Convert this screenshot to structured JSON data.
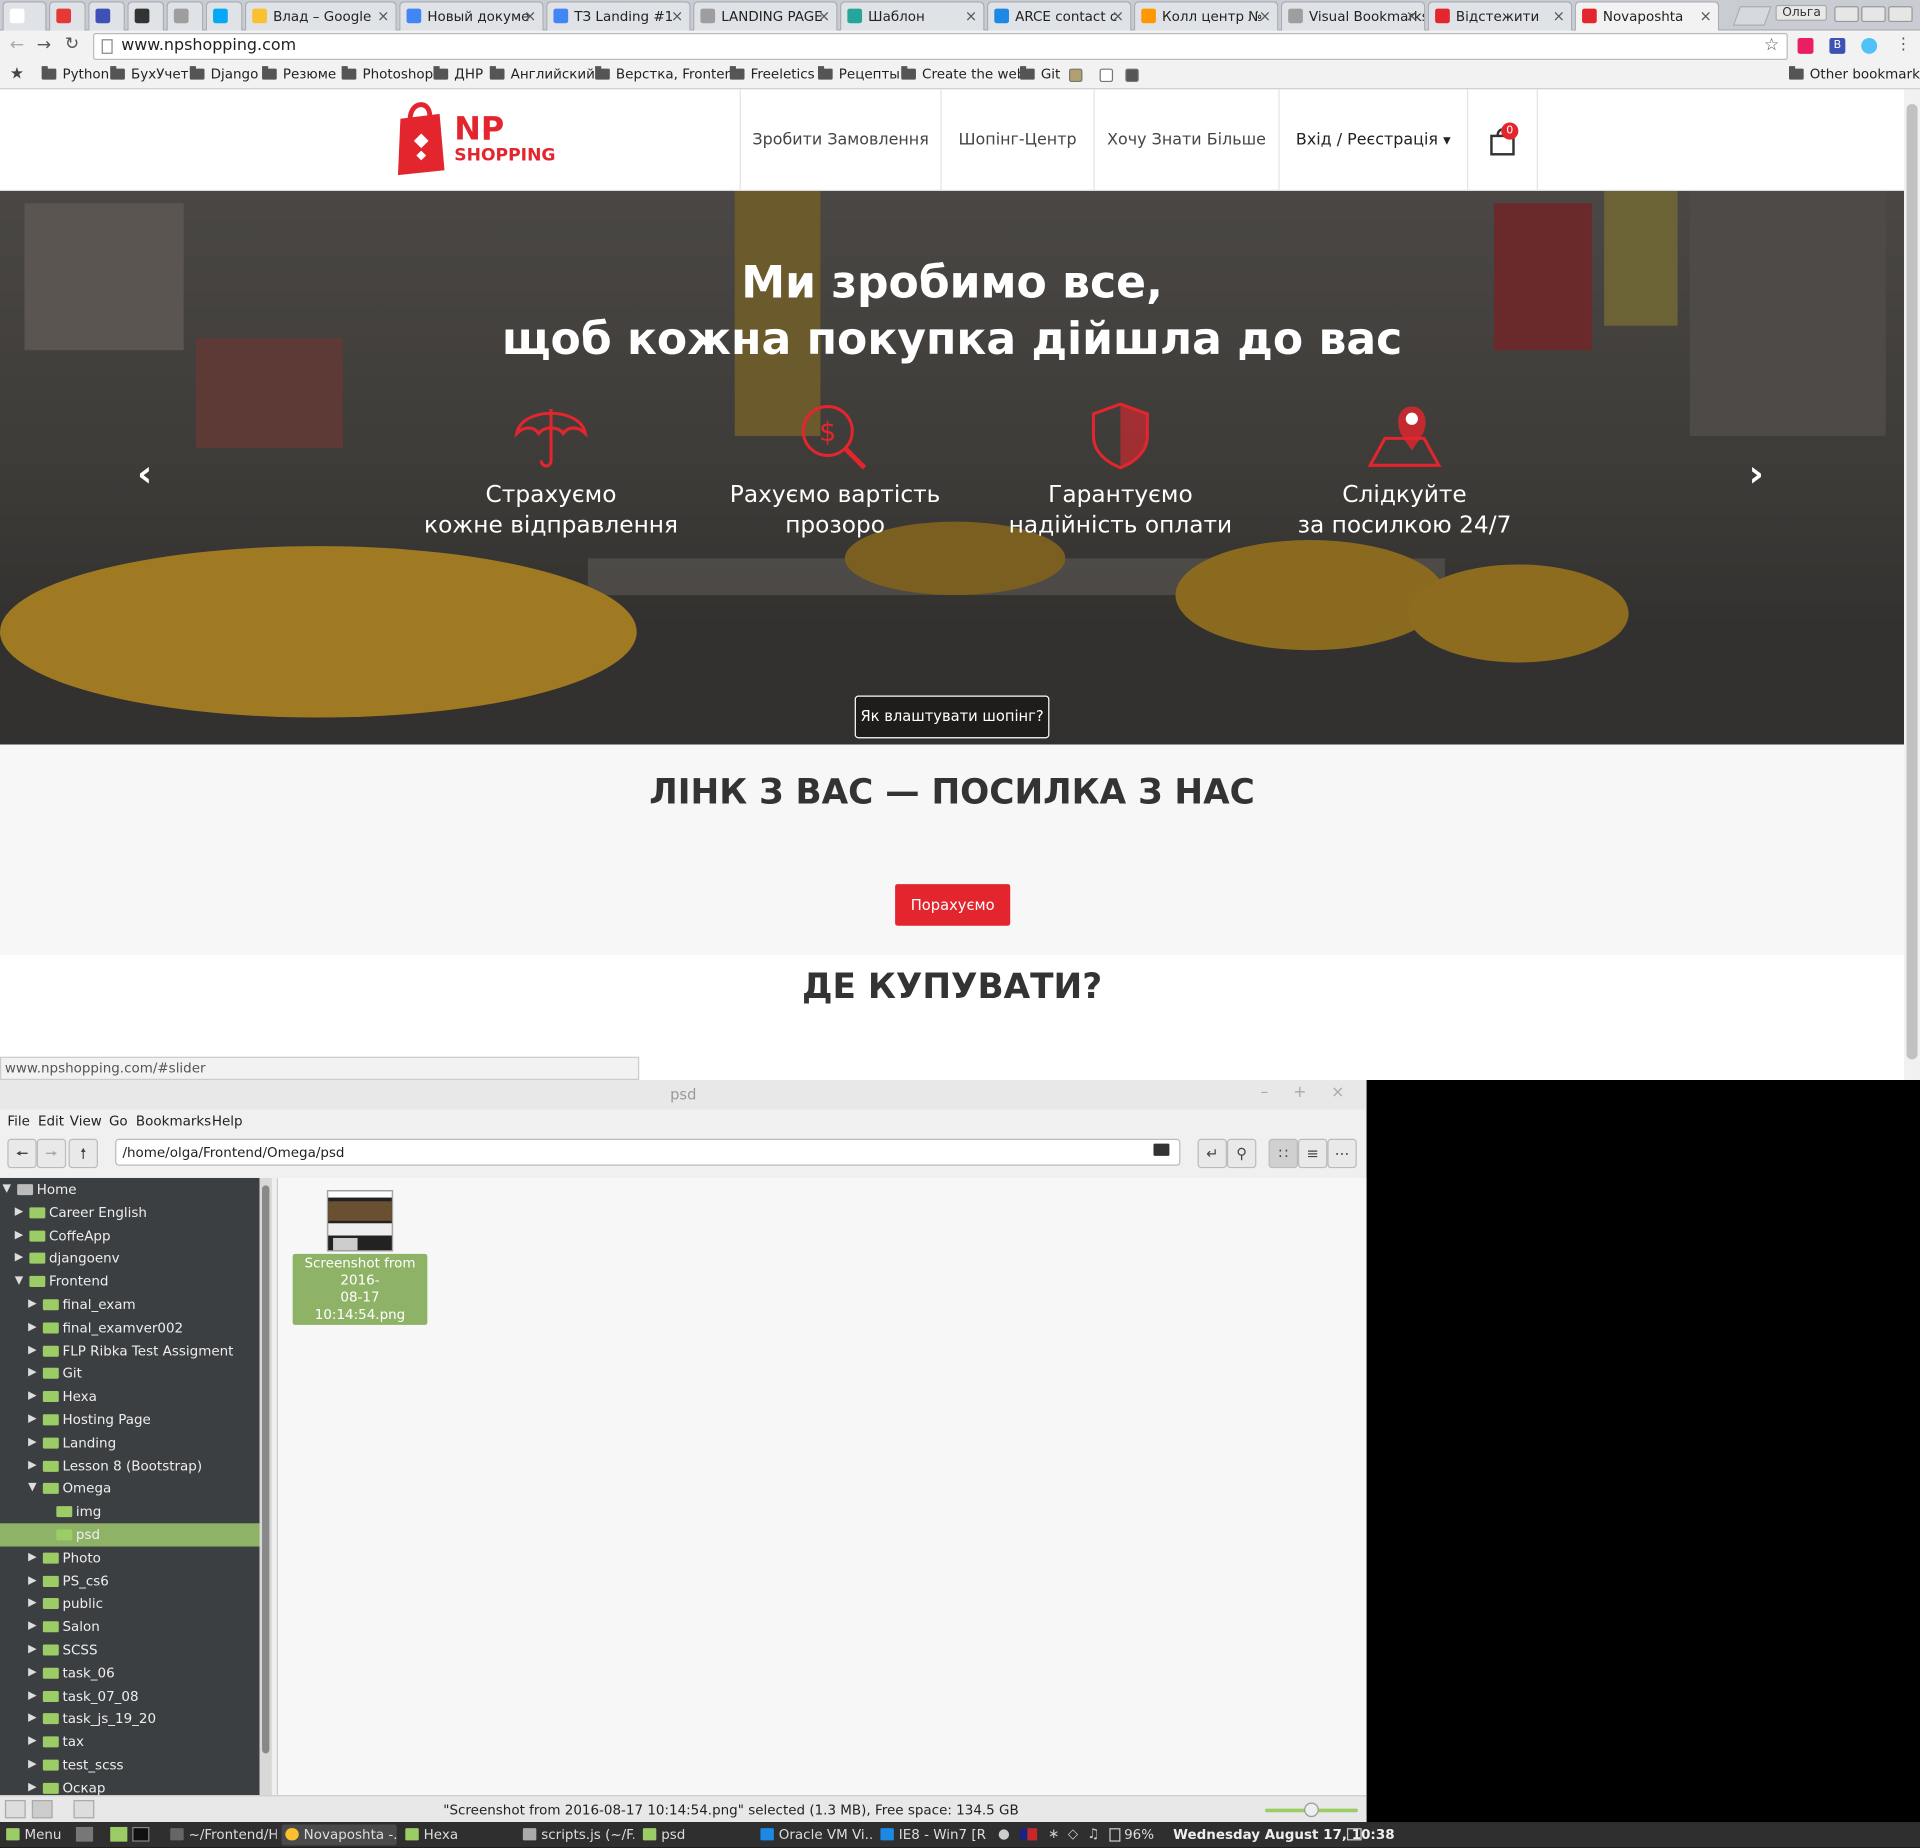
{
  "browser": {
    "tabs": [
      {
        "label": "",
        "favicon_color": "#ffffff"
      },
      {
        "label": "",
        "favicon_color": "#e53935"
      },
      {
        "label": "",
        "favicon_color": "#3f51b5"
      },
      {
        "label": "",
        "favicon_color": "#333333"
      },
      {
        "label": "",
        "favicon_color": "#9e9e9e"
      },
      {
        "label": "",
        "favicon_color": "#03a9f4"
      },
      {
        "label": "Влад – Google",
        "favicon_color": "#fbc02d"
      },
      {
        "label": "Новый докуме",
        "favicon_color": "#4285f4"
      },
      {
        "label": "ТЗ Landing #1",
        "favicon_color": "#4285f4"
      },
      {
        "label": "LANDING PAGE",
        "favicon_color": "#9e9e9e"
      },
      {
        "label": "Шаблон",
        "favicon_color": "#26a69a"
      },
      {
        "label": "ARCE contact c",
        "favicon_color": "#1e88e5"
      },
      {
        "label": "Колл центр №",
        "favicon_color": "#ff9800"
      },
      {
        "label": "Visual Bookmarks",
        "favicon_color": "#9e9e9e"
      },
      {
        "label": "Відстежити",
        "favicon_color": "#e3262e"
      },
      {
        "label": "Novaposhta",
        "favicon_color": "#e3262e"
      }
    ],
    "user_label": "Ольга",
    "url": "www.npshopping.com",
    "bookmarks": [
      "Python",
      "БухУчет",
      "Django",
      "Резюме",
      "Photoshop",
      "ДНР",
      "Английский",
      "Верстка, Frontend",
      "Freeletics",
      "Рецепты",
      "Create the web",
      "Git"
    ],
    "other_bookmarks": "Other bookmarks",
    "status_url": "www.npshopping.com/#slider"
  },
  "site": {
    "logo": {
      "line1": "NP",
      "line2": "SHOPPING"
    },
    "menu": [
      "Зробити Замовлення",
      "Шопінг-Центр",
      "Хочу Знати Більше"
    ],
    "login": "Вхід / Реєстрація",
    "cart_count": "0",
    "hero": {
      "title_line1": "Ми зробимо все,",
      "title_line2": "щоб кожна покупка дійшла до вас",
      "features": [
        {
          "line1": "Страхуємо",
          "line2": "кожне відправлення",
          "icon": "umbrella-icon"
        },
        {
          "line1": "Рахуємо вартість",
          "line2": "прозоро",
          "icon": "dollar-search-icon"
        },
        {
          "line1": "Гарантуємо",
          "line2": "надійність оплати",
          "icon": "shield-icon"
        },
        {
          "line1": "Слідкуйте",
          "line2": "за посилкою 24/7",
          "icon": "map-pin-icon"
        }
      ],
      "cta": "Як влаштувати шопінг?"
    },
    "section2": {
      "title": "ЛІНК З ВАС — ПОСИЛКА З НАС",
      "button": "Порахуємо"
    },
    "section3": {
      "title": "ДЕ КУПУВАТИ?"
    },
    "accent": "#e3262e"
  },
  "filemanager": {
    "title": "psd",
    "menu": [
      "File",
      "Edit",
      "View",
      "Go",
      "Bookmarks",
      "Help"
    ],
    "path": "/home/olga/Frontend/Omega/psd",
    "tree": [
      {
        "label": "Home",
        "level": 0,
        "expanded": true,
        "selected": false
      },
      {
        "label": "Career English",
        "level": 1,
        "expanded": false,
        "selected": false
      },
      {
        "label": "CoffeApp",
        "level": 1,
        "expanded": false,
        "selected": false
      },
      {
        "label": "djangoenv",
        "level": 1,
        "expanded": false,
        "selected": false
      },
      {
        "label": "Frontend",
        "level": 1,
        "expanded": true,
        "selected": false
      },
      {
        "label": "final_exam",
        "level": 2,
        "expanded": false,
        "selected": false
      },
      {
        "label": "final_examver002",
        "level": 2,
        "expanded": false,
        "selected": false
      },
      {
        "label": "FLP Ribka Test Assigment",
        "level": 2,
        "expanded": false,
        "selected": false
      },
      {
        "label": "Git",
        "level": 2,
        "expanded": false,
        "selected": false
      },
      {
        "label": "Hexa",
        "level": 2,
        "expanded": false,
        "selected": false
      },
      {
        "label": "Hosting Page",
        "level": 2,
        "expanded": false,
        "selected": false
      },
      {
        "label": "Landing",
        "level": 2,
        "expanded": false,
        "selected": false
      },
      {
        "label": "Lesson 8 (Bootstrap)",
        "level": 2,
        "expanded": false,
        "selected": false
      },
      {
        "label": "Omega",
        "level": 2,
        "expanded": true,
        "selected": false
      },
      {
        "label": "img",
        "level": 3,
        "expanded": null,
        "selected": false
      },
      {
        "label": "psd",
        "level": 3,
        "expanded": null,
        "selected": true
      },
      {
        "label": "Photo",
        "level": 2,
        "expanded": false,
        "selected": false
      },
      {
        "label": "PS_cs6",
        "level": 2,
        "expanded": false,
        "selected": false
      },
      {
        "label": "public",
        "level": 2,
        "expanded": false,
        "selected": false
      },
      {
        "label": "Salon",
        "level": 2,
        "expanded": false,
        "selected": false
      },
      {
        "label": "SCSS",
        "level": 2,
        "expanded": false,
        "selected": false
      },
      {
        "label": "task_06",
        "level": 2,
        "expanded": false,
        "selected": false
      },
      {
        "label": "task_07_08",
        "level": 2,
        "expanded": false,
        "selected": false
      },
      {
        "label": "task_js_19_20",
        "level": 2,
        "expanded": false,
        "selected": false
      },
      {
        "label": "tax",
        "level": 2,
        "expanded": false,
        "selected": false
      },
      {
        "label": "test_scss",
        "level": 2,
        "expanded": false,
        "selected": false
      },
      {
        "label": "Оскар",
        "level": 2,
        "expanded": false,
        "selected": false
      }
    ],
    "file": {
      "name_line1": "Screenshot from 2016-",
      "name_line2": "08-17 10:14:54.png"
    },
    "status": "\"Screenshot from 2016-08-17 10:14:54.png\" selected (1.3 MB), Free space: 134.5 GB"
  },
  "taskbar": {
    "menu": "Menu",
    "tasks": [
      "~/Frontend/H...",
      "Novaposhta -...",
      "Hexa",
      "scripts.js (~/F...",
      "psd",
      "Oracle VM Vi...",
      "IE8 - Win7 [R..."
    ],
    "battery": "96%",
    "clock": "Wednesday August 17, 10:38"
  }
}
